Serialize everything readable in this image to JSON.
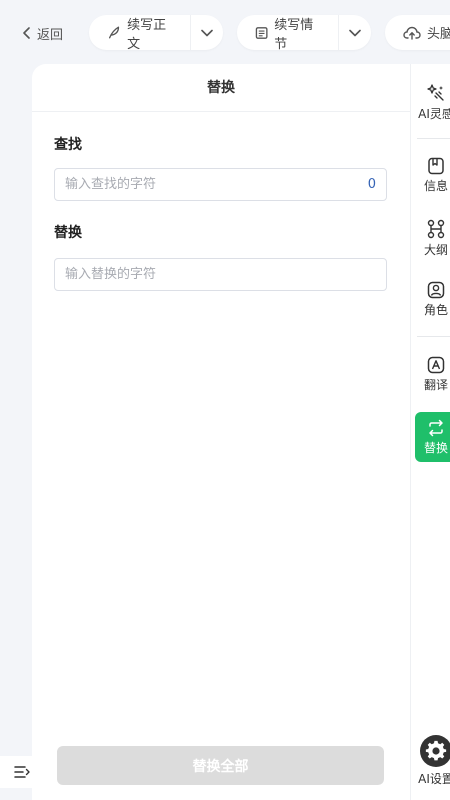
{
  "topbar": {
    "back_label": "返回",
    "continue_text_label": "续写正文",
    "continue_plot_label": "续写情节",
    "brainstorm_label": "头脑风暴"
  },
  "panel": {
    "title": "替换",
    "find_label": "查找",
    "find_placeholder": "输入查找的字符",
    "find_value": "",
    "match_count": "0",
    "replace_label": "替换",
    "replace_placeholder": "输入替换的字符",
    "replace_value": "",
    "replace_all_label": "替换全部"
  },
  "sidebar": {
    "items": [
      {
        "label": "AI灵感",
        "icon": "sparkle-icon"
      },
      {
        "label": "信息",
        "icon": "book-icon"
      },
      {
        "label": "大纲",
        "icon": "outline-icon"
      },
      {
        "label": "角色",
        "icon": "person-icon"
      },
      {
        "label": "翻译",
        "icon": "translate-icon"
      },
      {
        "label": "替换",
        "icon": "swap-icon",
        "active": true
      }
    ],
    "settings_label": "AI设置"
  },
  "colors": {
    "accent_green": "#1fbf6a",
    "count_blue": "#3563b5",
    "disabled_button": "#dcdcdc",
    "background": "#f3f5f9"
  }
}
